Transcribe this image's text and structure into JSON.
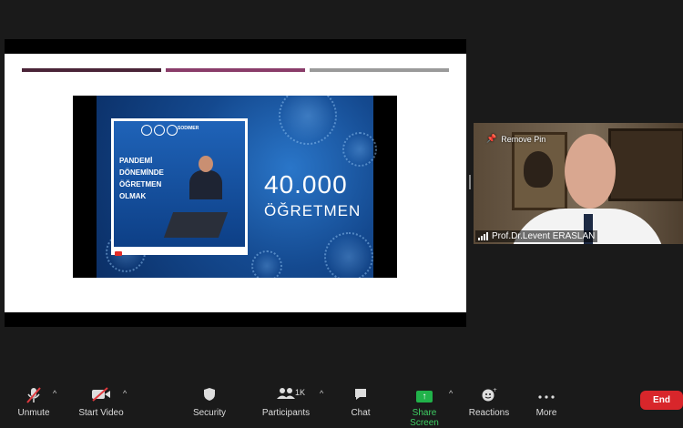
{
  "slide": {
    "poster_brand": "SODIMER",
    "poster_title_1": "PANDEMİ",
    "poster_title_2": "DÖNEMİNDE",
    "poster_title_3": "ÖĞRETMEN",
    "poster_title_4": "OLMAK",
    "big_number": "40.000",
    "big_word": "ÖĞRETMEN"
  },
  "participant": {
    "remove_pin_label": "Remove Pin",
    "name": "Prof.Dr.Levent ERASLAN"
  },
  "toolbar": {
    "unmute": "Unmute",
    "start_video": "Start Video",
    "security": "Security",
    "participants": "Participants",
    "participants_count": "1K",
    "chat": "Chat",
    "share_screen": "Share Screen",
    "reactions": "Reactions",
    "more": "More",
    "end": "End"
  },
  "colors": {
    "end_button": "#d8262b",
    "share_green": "#21b24a",
    "slide_bar_1": "#4a2438",
    "slide_bar_2": "#8a3d6a",
    "slide_bar_3": "#9a9a9a"
  },
  "icons": [
    "microphone-muted-icon",
    "video-off-icon",
    "shield-icon",
    "participants-icon",
    "chat-bubble-icon",
    "share-screen-icon",
    "reactions-icon",
    "more-dots-icon",
    "pin-icon",
    "signal-icon"
  ]
}
